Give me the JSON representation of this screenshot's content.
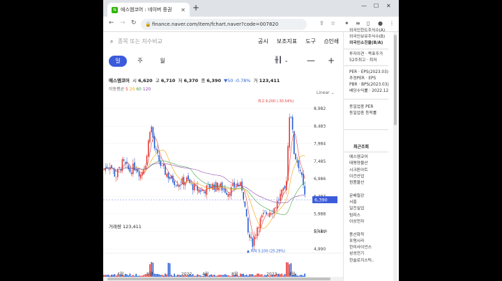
{
  "browser": {
    "tab_title": "에스엠코어 : 네이버 증권",
    "url": "finance.naver.com/item/fchart.naver?code=007820"
  },
  "header": {
    "search_placeholder": "종목 또는 지수비교",
    "menu": [
      "공시",
      "보조지표",
      "도구",
      "인쇄"
    ]
  },
  "periods": [
    {
      "label": "일",
      "active": true
    },
    {
      "label": "주",
      "active": false
    },
    {
      "label": "월",
      "active": false
    }
  ],
  "stock": {
    "name": "에스엠코어",
    "open_label": "시",
    "open": "6,620",
    "high_label": "고",
    "high": "6,710",
    "low_label": "저",
    "low": "6,370",
    "close_label": "종",
    "close": "6,390",
    "change": "▼50",
    "change_pct": "-0.78%",
    "volume_label": "거",
    "volume": "123,411"
  },
  "moving_avg": {
    "label": "이동평균",
    "periods": [
      "5",
      "20",
      "60",
      "120"
    ]
  },
  "scale_mode": "Linear",
  "chart_data": {
    "type": "candlestick",
    "price_ticks": [
      "8,982",
      "8,483",
      "7,984",
      "7,485",
      "6,986",
      "6,487",
      "5,988",
      "5,489",
      "4,990"
    ],
    "current_price": "6,390",
    "high_annotation": "최고 9,200 (-30.54%)",
    "low_annotation": "최저 5,100 (25.29%)",
    "volume_label": "거래량 123,411",
    "volume_max": "10.1m",
    "x_ticks": [
      "4월",
      "8월",
      "2022",
      "4월",
      "8월",
      "2023",
      "4월"
    ],
    "colors": {
      "up": "#e53935",
      "down": "#1e5bd6",
      "ma5": "#e53935",
      "ma20": "#f4a300",
      "ma60": "#43a047",
      "ma120": "#8e44ad"
    }
  },
  "side": {
    "top_items": [
      "외국인한도주식수(A)",
      "외국인보유주식수(B)",
      "외국인소진율(B/A)"
    ],
    "mid_items": [
      "투자의견 · 목표주가",
      "52주최고 · 최저"
    ],
    "per_items": [
      "PER · EPS(2023.03)",
      "추정PER · EPS",
      "PBR · BPS(2023.03)",
      "배당수익률 · 2022.12"
    ],
    "sector_items": [
      "동일업종 PER",
      "동일업종 등락률"
    ],
    "recent_title": "최근조회",
    "recent": [
      "에스엠코어",
      "태평양물산",
      "시크톤아트",
      "이건산업",
      "원풍물산",
      "",
      "문배철강",
      "서흥",
      "일진실업",
      "팀피스",
      "이상전자",
      "",
      "풍산화학",
      "포탱시라",
      "한미사이언스",
      "삼성전기",
      "한솔로지스틱.."
    ]
  }
}
